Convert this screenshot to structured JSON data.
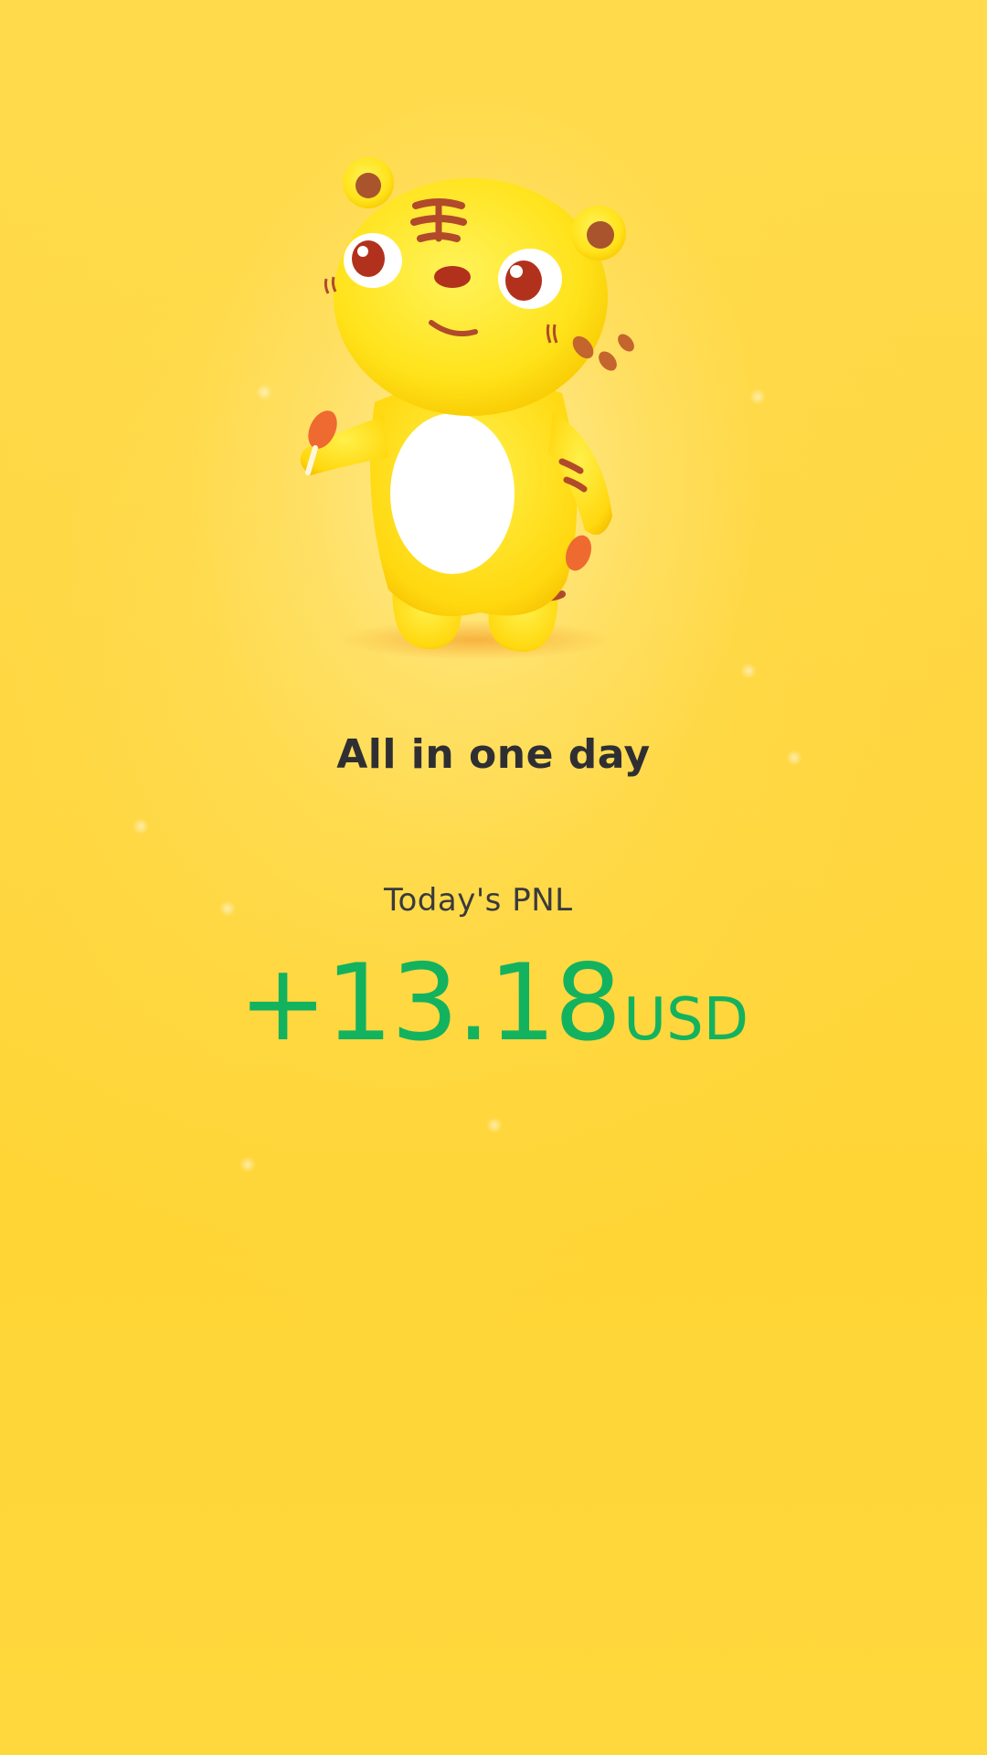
{
  "headline": "All in one day",
  "pnl": {
    "label": "Today's PNL",
    "value": "+13.18",
    "unit": "USD"
  },
  "colors": {
    "background": "#ffd93a",
    "headline": "#2f2f33",
    "label": "#3a3a3d",
    "pnl_positive": "#13b25f",
    "mascot_body": "#ffde1a",
    "mascot_stripes": "#b04a2a",
    "mascot_belly": "#ffffff"
  },
  "icons": {
    "mascot": "tiger-mascot-illustration"
  }
}
